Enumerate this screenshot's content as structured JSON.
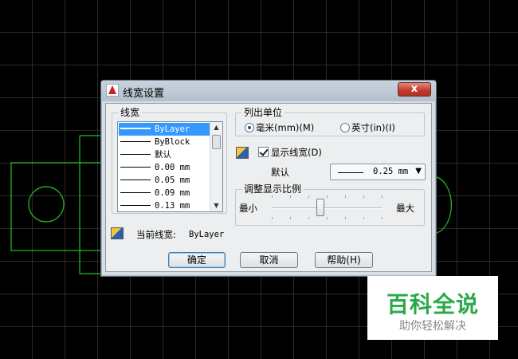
{
  "dialog": {
    "title": "线宽设置",
    "close_label": "x"
  },
  "lineweights": {
    "group_label": "线宽",
    "items": [
      "ByLayer",
      "ByBlock",
      "默认",
      "0.00 mm",
      "0.05 mm",
      "0.09 mm",
      "0.13 mm"
    ],
    "selected": "ByLayer",
    "current_label": "当前线宽:",
    "current_value": "ByLayer"
  },
  "units": {
    "group_label": "列出单位",
    "option_mm": "毫米(mm)(M)",
    "option_in": "英寸(in)(I)",
    "selected": "option_mm"
  },
  "display": {
    "checkbox_label": "显示线宽(D)",
    "checked": true,
    "default_label": "默认",
    "default_value": "0.25 mm"
  },
  "scale": {
    "group_label": "调整显示比例",
    "min_label": "最小",
    "max_label": "最大",
    "level_fraction": 0.44
  },
  "buttons": {
    "ok": "确定",
    "cancel": "取消",
    "help": "帮助(H)"
  },
  "watermark": {
    "title": "百科全说",
    "subtitle": "助你轻松解决"
  },
  "colors": {
    "cad_line": "#22c022",
    "selection": "#3399ff"
  }
}
